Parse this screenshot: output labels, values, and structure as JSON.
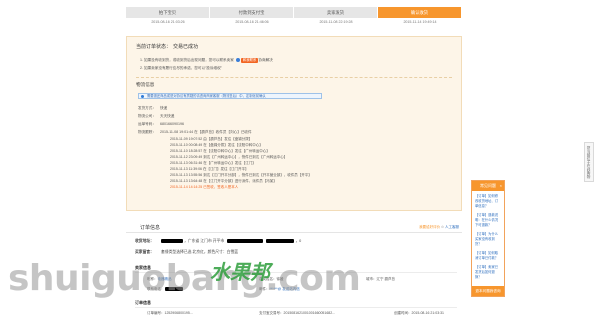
{
  "steps": [
    {
      "label": "拍下宝贝",
      "time": "2015-08-16 21:03:26",
      "state": "done"
    },
    {
      "label": "付款到支付宝",
      "time": "2015-08-16 21:46:06",
      "state": "done"
    },
    {
      "label": "卖家发货",
      "time": "2015-11-08 22:19:28",
      "state": "done"
    },
    {
      "label": "确认收货",
      "time": "2015-11-14 19:49:14",
      "state": "active"
    }
  ],
  "status": {
    "label": "当前订单状态：",
    "value": "交易已成功",
    "tip1_prefix": "1. 如果没有收到货，或收到货后出现问题，您可以联系卖家",
    "tip1_button": "和我联系",
    "tip1_suffix": "协商解决",
    "tip2": "2. 如果卖家没有履行应尽的承诺，您可以“投诉维权”"
  },
  "logistics": {
    "title": "物流信息",
    "notice": "需要退还商品或是对协议有质疑的请咨询商家客服（物流售后）中，定制化前确认",
    "fields": [
      {
        "key": "发货方式：",
        "value": "快递"
      },
      {
        "key": "物流公司：",
        "value": "天天快递"
      },
      {
        "key": "运单号码：",
        "value": "680166090196"
      },
      {
        "key": "物流跟踪：",
        "value": "2015-11-08 19:01:44 在【葫芦岛】收件员【刘心】已收件"
      }
    ],
    "entries": [
      "2015-11-09 19:07:52 由【葫芦岛】发往【盘锦分拨】",
      "2015-11-10 00:08:49 在【盘锦分拨】发往【沈阳中转中心】",
      "2015-11-10 18:28:57 在【沈阳中转中心】发往【广州转运中心】",
      "2015-11-12 23:09:49 到达【广州转运中心】，快件已到达【广州转运中心】",
      "2015-11-13 06:31:46 在【广州转运中心】发往【江门】",
      "2015-11-13 11:39:06 在【江门】发往【江门开平】",
      "2015-11-13 13:55:56 到达【江门开平分部】，快件已到达【开平营业部】，收件员【开平】",
      "2015-11-13 13:64:48 在【江门开平分部】进行派件，派件员【冯某】",
      "2015-11-14 14:14:25 已签收，签收人是本人"
    ]
  },
  "order_info": {
    "title": "订单信息",
    "right_link1": "我要给好评价",
    "right_link2": "人工客服",
    "address_key": "收货地址：",
    "address_value": "，广东省 江门市 开平市",
    "address_tail": "，0",
    "buyer_note_key": "买家留言：",
    "buyer_note_value": "套餐类型选择已选 北京红，颜色尺寸：白雪蓝",
    "seller_section": "卖家信息",
    "seller_row": [
      {
        "key": "昵称：",
        "value": "电器精品"
      },
      {
        "key": "真实姓名：",
        "value": "徐媛"
      },
      {
        "key": "城市：",
        "value": "辽宁 葫芦岛"
      }
    ],
    "seller_row2": [
      {
        "key": "联系电话：",
        "value": ""
      },
      {
        "key": "邮件：",
        "value": "******@ 发送站内信"
      }
    ],
    "order_section": "订单信息",
    "order_row": [
      {
        "key": "订单编号：",
        "value": "1252906800195..."
      },
      {
        "key": "支付宝交易号：",
        "value": "2015081621001001660051682..."
      },
      {
        "key": "创建时间：",
        "value": "2015-08-16 21:03:31"
      }
    ]
  },
  "side": {
    "vtab": "您当前位于在线购物",
    "header": "常见问题",
    "items": [
      "【订单】如何修改收货地址、订单信息？",
      "【订单】退款说明：在什么情况下可退款？",
      "【订单】为什么买家没有收到货？",
      "【订单】如何取消订单已付款？",
      "【订单】卖家已发货后如何退换？"
    ],
    "footer": "退本问题我咨询"
  },
  "watermark": {
    "main": "shuiguobang.com",
    "cn": "水果邦"
  }
}
